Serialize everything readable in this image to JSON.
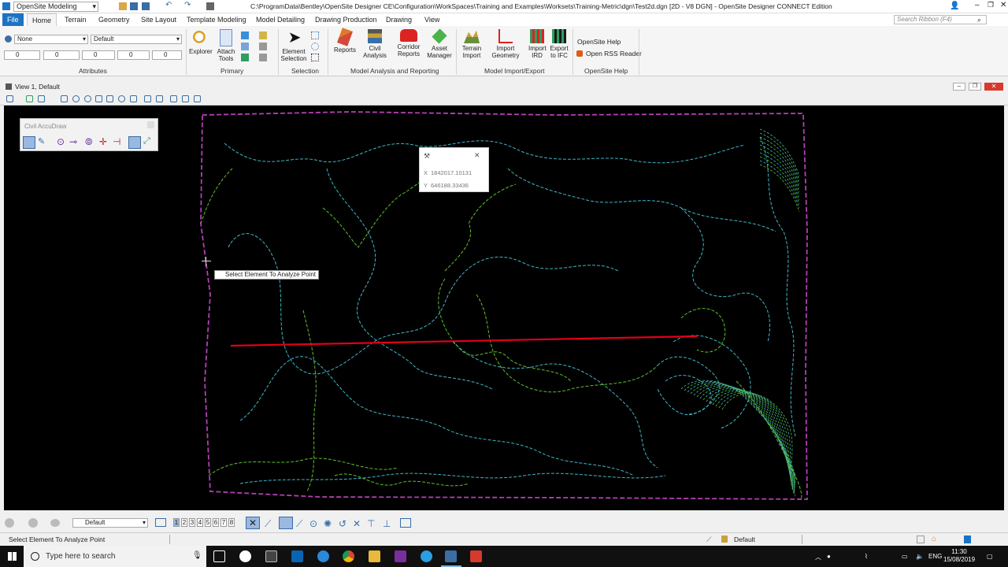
{
  "titlebar": {
    "workflow": "OpenSite Modeling",
    "title": "C:\\ProgramData\\Bentley\\OpenSite Designer CE\\Configuration\\WorkSpaces\\Training and Examples\\Worksets\\Training-Metric\\dgn\\Test2d.dgn [2D - V8 DGN] - OpenSite Designer CONNECT Edition"
  },
  "tabs": [
    "File",
    "Home",
    "Terrain",
    "Geometry",
    "Site Layout",
    "Template Modeling",
    "Model Detailing",
    "Drawing Production",
    "Drawing",
    "View"
  ],
  "search": {
    "placeholder": "Search Ribbon (F4)"
  },
  "ribbon": {
    "attributes": {
      "level": "None",
      "style": "Default",
      "color": "0",
      "weight": "0",
      "linestyle": "0",
      "transparency": "0",
      "priority": "0",
      "label": "Attributes"
    },
    "primary": {
      "explorer": "Explorer",
      "attach": "Attach Tools",
      "label": "Primary"
    },
    "selection": {
      "element": "Element Selection",
      "label": "Selection"
    },
    "analysis": {
      "reports": "Reports",
      "civil": "Civil Analysis",
      "corridor": "Corridor Reports",
      "asset": "Asset Manager",
      "label": "Model Analysis and Reporting"
    },
    "import": {
      "terrain": "Terrain Import",
      "geometry": "Import Geometry",
      "ird": "Import IRD",
      "ifc": "Export to IFC",
      "label": "Model Import/Export"
    },
    "help": {
      "help": "OpenSite Help",
      "rss": "Open RSS Reader",
      "label": "OpenSite Help"
    }
  },
  "view": {
    "title": "View 1, Default"
  },
  "accudraw": {
    "title": "Civil AccuDraw"
  },
  "coords": {
    "x_label": "X",
    "x_value": "1842017.10131",
    "y_label": "Y",
    "y_value": "646188.33436"
  },
  "tooltip": "Select Element To Analyze Point",
  "bottom": {
    "viewgroup": "Default",
    "views": [
      "1",
      "2",
      "3",
      "4",
      "5",
      "6",
      "7",
      "8"
    ]
  },
  "status": {
    "message": "Select Element To Analyze Point",
    "model": "Default"
  },
  "taskbar": {
    "search": "Type here to search",
    "lang": "ENG",
    "time": "11:30",
    "date": "15/08/2019"
  },
  "colors": {
    "contour_cyan": "#3fb7c8",
    "contour_green": "#5ec02a",
    "boundary": "#b43fb4",
    "profile_line": "#e0001a",
    "accent": "#1c73c4"
  }
}
